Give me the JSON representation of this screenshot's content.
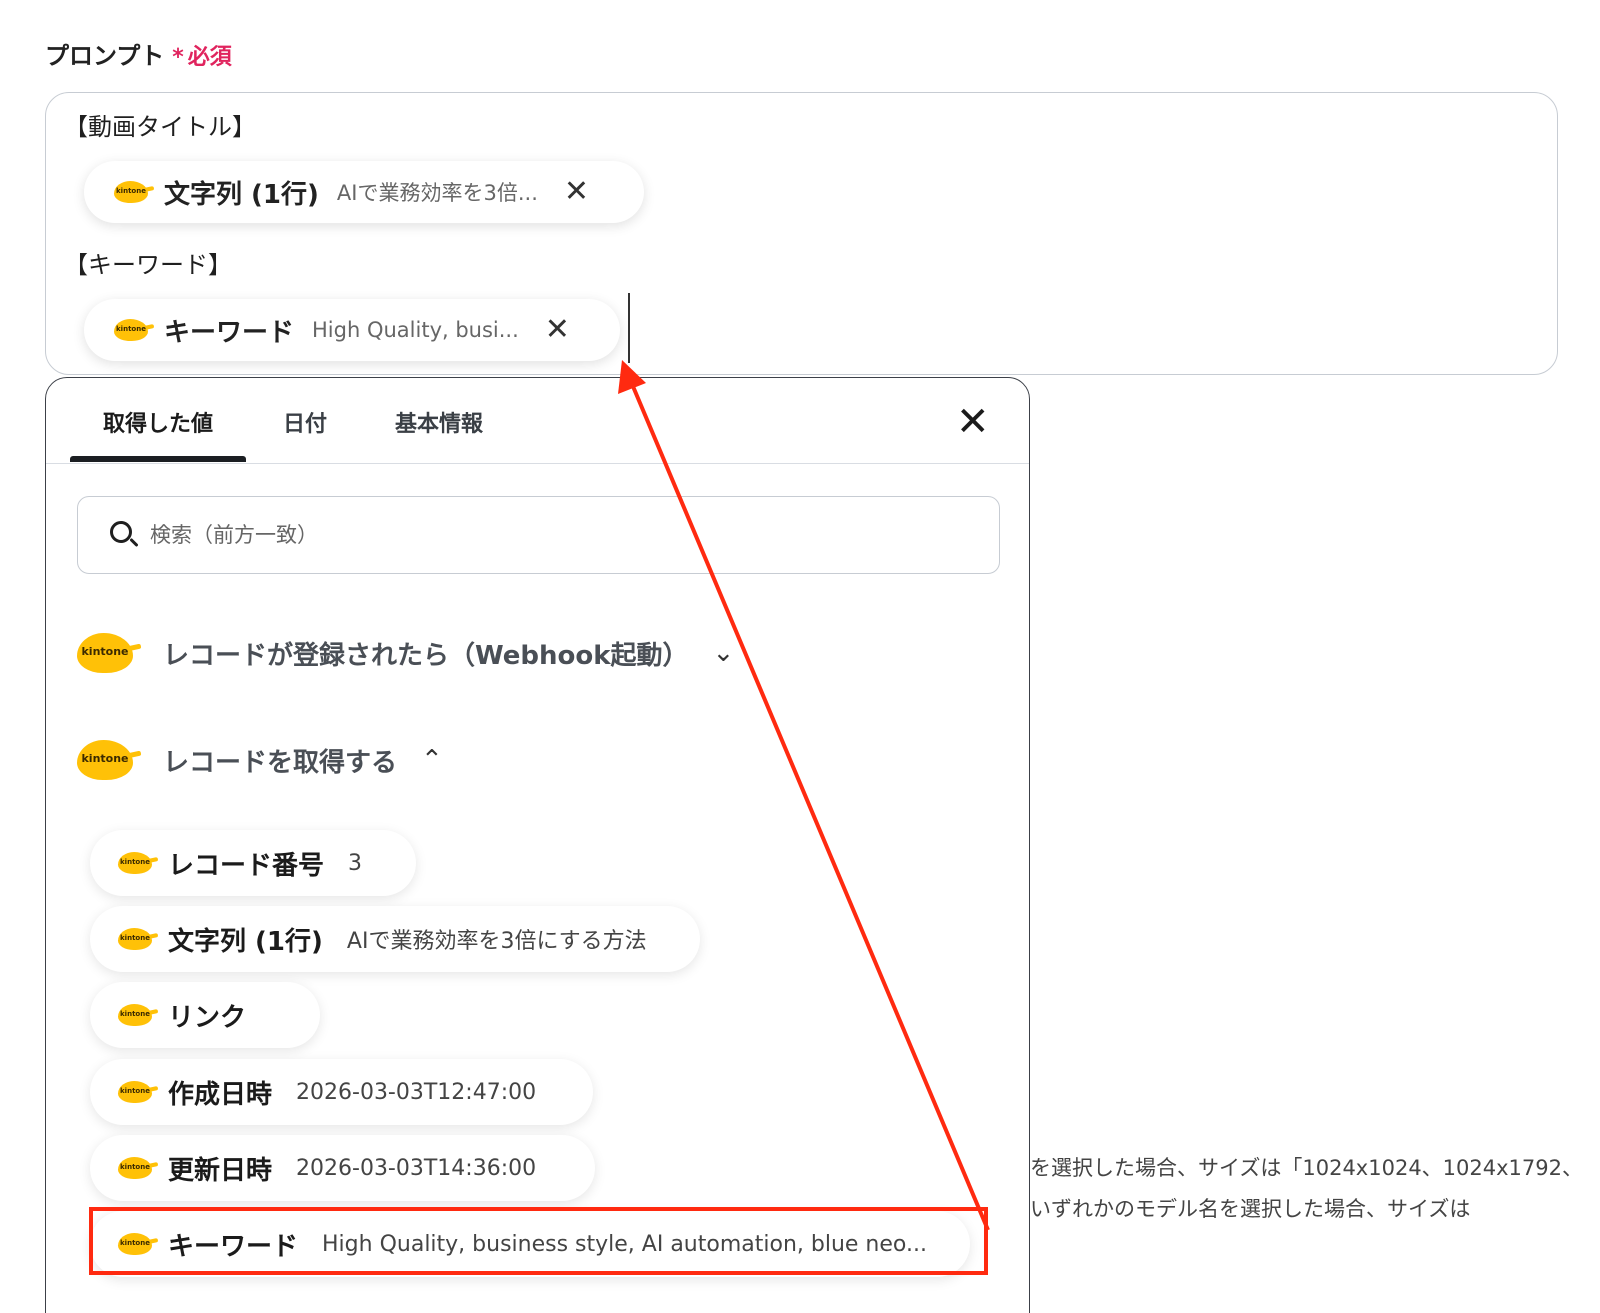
{
  "field": {
    "label": "プロンプト",
    "required_mark": "*",
    "required_text": "必須"
  },
  "prompt": {
    "line1": "【動画タイトル】",
    "line2": "【キーワード】",
    "chip1": {
      "name": "文字列 (1行)",
      "value": "AIで業務効率を3倍...",
      "remove": "✕"
    },
    "chip2": {
      "name": "キーワード",
      "value": "High Quality, busi...",
      "remove": "✕"
    }
  },
  "panel": {
    "tabs": [
      "取得した値",
      "日付",
      "基本情報"
    ],
    "active_tab": "取得した値",
    "close": "✕",
    "search_placeholder": "検索（前方一致）",
    "groups": [
      {
        "title": "レコードが登録されたら（Webhook起動）",
        "chevron": "⌄",
        "expanded": false
      },
      {
        "title": "レコードを取得する",
        "chevron": "⌃",
        "expanded": true
      }
    ],
    "items": [
      {
        "name": "レコード番号",
        "value": "3"
      },
      {
        "name": "文字列 (1行)",
        "value": "AIで業務効率を3倍にする方法"
      },
      {
        "name": "リンク",
        "value": ""
      },
      {
        "name": "作成日時",
        "value": "2026-03-03T12:47:00"
      },
      {
        "name": "更新日時",
        "value": "2026-03-03T14:36:00"
      },
      {
        "name": "キーワード",
        "value": "High Quality, business style, AI automation, blue neo..."
      }
    ],
    "logo_text": "kintone"
  },
  "background": {
    "line1": "を選択した場合、サイズは「1024x1024、1024x1792、",
    "line2": "いずれかのモデル名を選択した場合、サイズは"
  },
  "colors": {
    "required": "#e0245e",
    "kintone_logo": "#ffc107",
    "annotation_red": "#ff2a10"
  },
  "icons": [
    "kintone-logo-icon",
    "close-icon",
    "search-icon",
    "chevron-down-icon",
    "chevron-up-icon"
  ]
}
